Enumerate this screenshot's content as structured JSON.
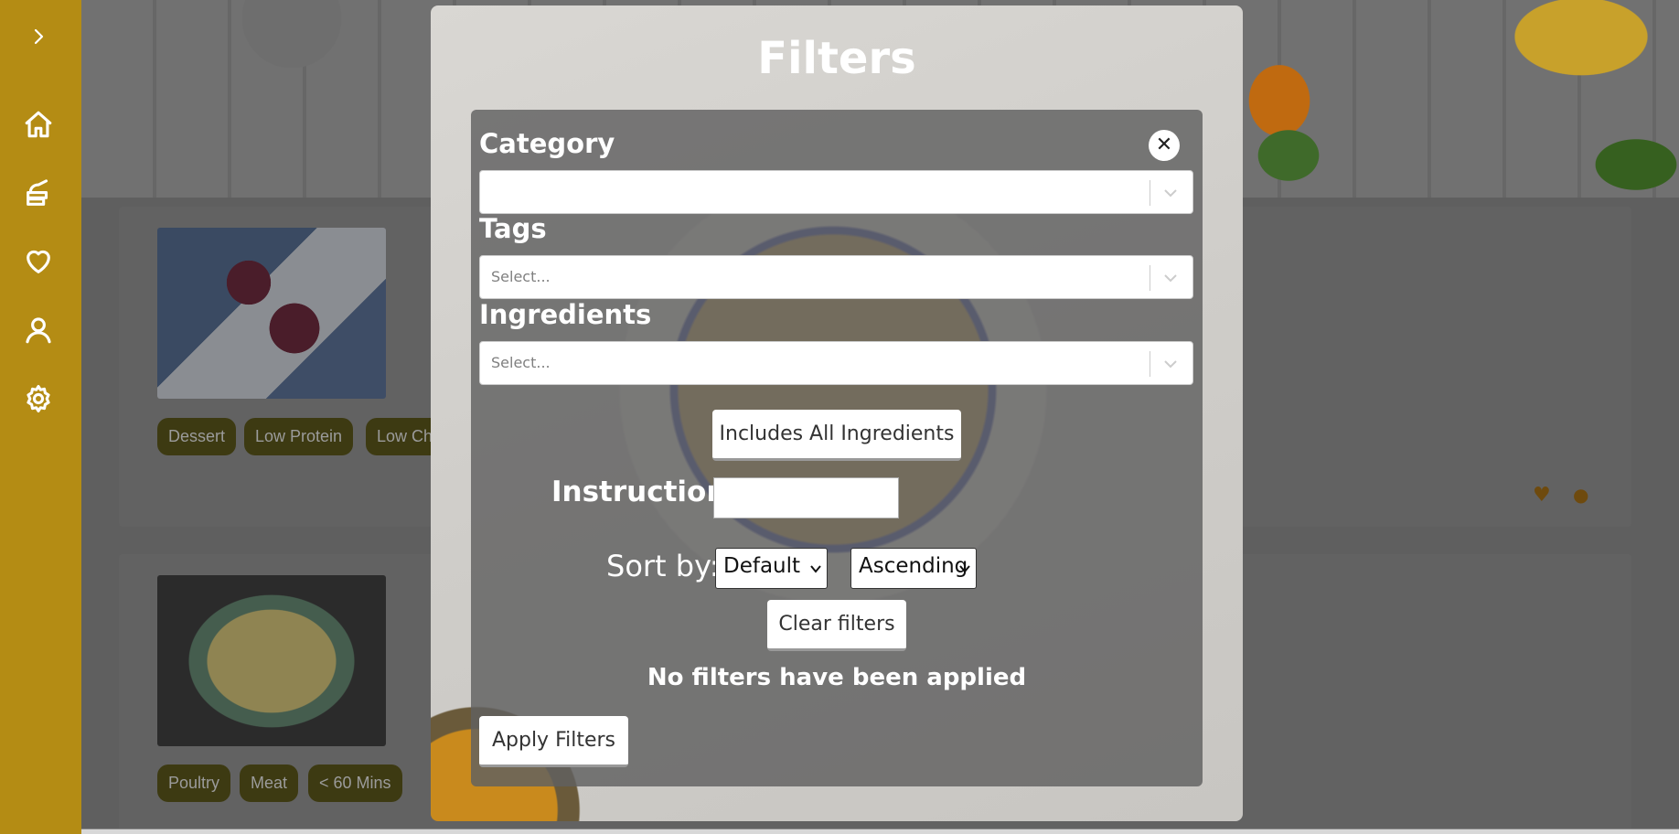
{
  "sidebar": {
    "icons": [
      "chevron-right-icon",
      "home-icon",
      "meal-icon",
      "heart-icon",
      "user-icon",
      "gear-icon"
    ]
  },
  "background": {
    "cards": [
      {
        "tags": [
          "Dessert",
          "Low Protein",
          "Low Ch"
        ]
      },
      {
        "tags": [
          "Poultry",
          "Meat",
          "< 60 Mins"
        ]
      }
    ]
  },
  "modal": {
    "title": "Filters",
    "category_label": "Category",
    "category_value": "",
    "tags_label": "Tags",
    "tags_placeholder": "Select...",
    "ingredients_label": "Ingredients",
    "ingredients_placeholder": "Select...",
    "includes_all_button": "Includes All Ingredients",
    "instructions_label": "Instructions:",
    "instructions_value": "",
    "sort_label": "Sort by:",
    "sort_field": "Default",
    "sort_order": "Ascending",
    "clear_button": "Clear filters",
    "status_text": "No filters have been applied",
    "apply_button": "Apply Filters",
    "close_symbol": "✕"
  },
  "colors": {
    "sidebar": "#b48c14",
    "tag_bg": "#3d3a12"
  }
}
